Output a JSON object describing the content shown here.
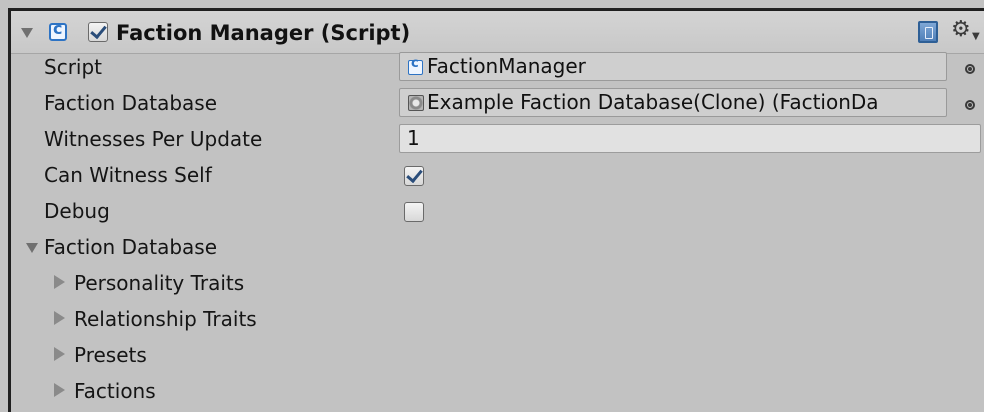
{
  "component": {
    "title": "Faction Manager (Script)",
    "enabled": true
  },
  "properties": {
    "script": {
      "label": "Script",
      "value": "FactionManager"
    },
    "faction_database": {
      "label": "Faction Database",
      "value": "Example Faction Database(Clone) (FactionDa"
    },
    "witnesses_per_update": {
      "label": "Witnesses Per Update",
      "value": "1"
    },
    "can_witness_self": {
      "label": "Can Witness Self",
      "checked": true
    },
    "debug": {
      "label": "Debug",
      "checked": false
    }
  },
  "faction_database_section": {
    "label": "Faction Database",
    "expanded": true,
    "children": [
      {
        "label": "Personality Traits",
        "expanded": false
      },
      {
        "label": "Relationship Traits",
        "expanded": false
      },
      {
        "label": "Presets",
        "expanded": false
      },
      {
        "label": "Factions",
        "expanded": false
      }
    ]
  },
  "icons": {
    "header_fold": "triangle-down-icon",
    "component": "csharp-script-icon",
    "help": "book-icon",
    "settings": "gear-icon",
    "object_picker": "object-picker-icon"
  },
  "colors": {
    "background": "#c2c2c2",
    "field": "#cfcfcf",
    "editable_field": "#e1e1e1",
    "accent": "#2d73c4"
  }
}
